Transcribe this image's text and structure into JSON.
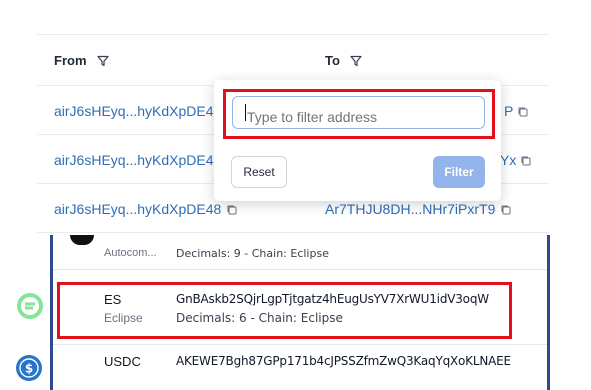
{
  "table": {
    "headers": {
      "from": "From",
      "to": "To"
    },
    "rows": [
      {
        "from": "airJ6sHEyq...hyKdXpDE4",
        "to_partial": "P"
      },
      {
        "from": "airJ6sHEyq...hyKdXpDE4",
        "to_partial": "Yx"
      },
      {
        "from": "airJ6sHEyq...hyKdXpDE48",
        "to": "Ar7THJU8DH...NHr7iPxrT9"
      }
    ]
  },
  "filter_popover": {
    "placeholder": "Type to filter address",
    "reset_label": "Reset",
    "filter_label": "Filter"
  },
  "token_list": {
    "partial": {
      "name": "Autocom...",
      "meta": "Decimals: 9 - Chain: Eclipse"
    },
    "tokens": [
      {
        "symbol": "ES",
        "chain": "Eclipse",
        "address": "GnBAskb2SQjrLgpTjtgatz4hEugUsYV7XrWU1idV3oqW",
        "meta": "Decimals: 6 - Chain: Eclipse"
      },
      {
        "symbol": "USDC",
        "address": "AKEWE7Bgh87GPp171b4cJPSSZfmZwQ3KaqYqXoKLNAEE"
      }
    ]
  },
  "colors": {
    "link": "#2f6eb6",
    "highlight": "#e3101c",
    "panel_border": "#2c4a8d",
    "filter_button": "#93b4ea",
    "es_logo": "#86e39a",
    "usdc_logo": "#2775ca"
  }
}
